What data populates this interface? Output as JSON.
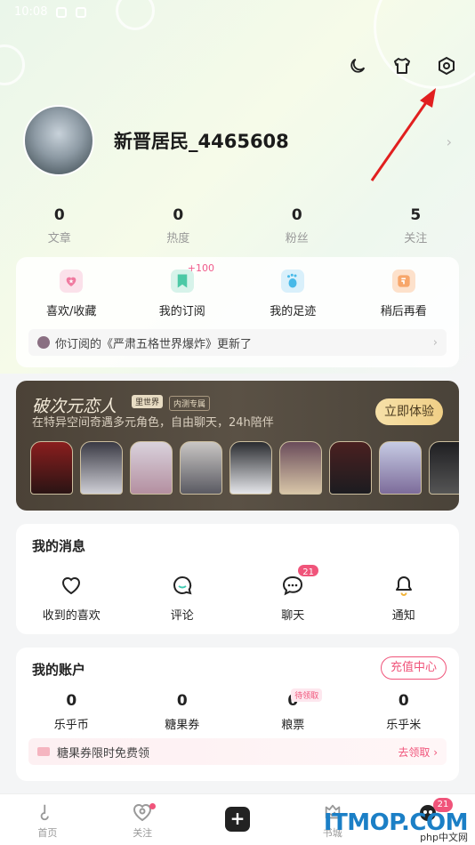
{
  "status": {
    "time": "10:08"
  },
  "profile": {
    "username": "新晋居民_4465608"
  },
  "stats": [
    {
      "value": "0",
      "label": "文章"
    },
    {
      "value": "0",
      "label": "热度"
    },
    {
      "value": "0",
      "label": "粉丝"
    },
    {
      "value": "5",
      "label": "关注"
    }
  ],
  "quick": {
    "items": [
      {
        "label": "喜欢/收藏",
        "icon": "heart-star-icon",
        "color": "#f07aa0"
      },
      {
        "label": "我的订阅",
        "icon": "bookmark-icon",
        "color": "#4cc9a6",
        "extra": "+100"
      },
      {
        "label": "我的足迹",
        "icon": "footprint-icon",
        "color": "#47b9e8"
      },
      {
        "label": "稍后再看",
        "icon": "watch-later-icon",
        "color": "#f7a66a"
      }
    ],
    "notice": "你订阅的《严肃五格世界爆炸》更新了"
  },
  "banner": {
    "title": "破次元恋人",
    "tag_brand": "里世界",
    "tag": "内测专属",
    "subtitle": "在特异空间奇遇多元角色，自由聊天，24h陪伴",
    "cta": "立即体验"
  },
  "messages": {
    "title": "我的消息",
    "items": [
      {
        "label": "收到的喜欢",
        "icon": "heart-outline-icon"
      },
      {
        "label": "评论",
        "icon": "comment-icon"
      },
      {
        "label": "聊天",
        "icon": "chat-icon",
        "badge": "21"
      },
      {
        "label": "通知",
        "icon": "bell-icon"
      }
    ]
  },
  "account": {
    "title": "我的账户",
    "recharge": "充值中心",
    "items": [
      {
        "value": "0",
        "label": "乐乎币"
      },
      {
        "value": "0",
        "label": "糖果券"
      },
      {
        "value": "0",
        "label": "粮票",
        "pending": "待领取"
      },
      {
        "value": "0",
        "label": "乐乎米"
      }
    ],
    "promo": "糖果券限时免费领",
    "promo_action": "去领取"
  },
  "tabs": [
    {
      "label": "首页",
      "icon": "home-icon"
    },
    {
      "label": "关注",
      "icon": "follow-icon",
      "dot": true
    },
    {
      "label": "",
      "icon": "publish-plus-icon"
    },
    {
      "label": "书城",
      "icon": "bookstore-icon"
    },
    {
      "label": "",
      "icon": "profile-avatar-icon",
      "badge": "21"
    }
  ],
  "watermark": {
    "brand": "ITMOP.COM",
    "sub": "php中文网"
  },
  "colors": {
    "accent": "#f0547a",
    "cta": "#f0cf86"
  }
}
